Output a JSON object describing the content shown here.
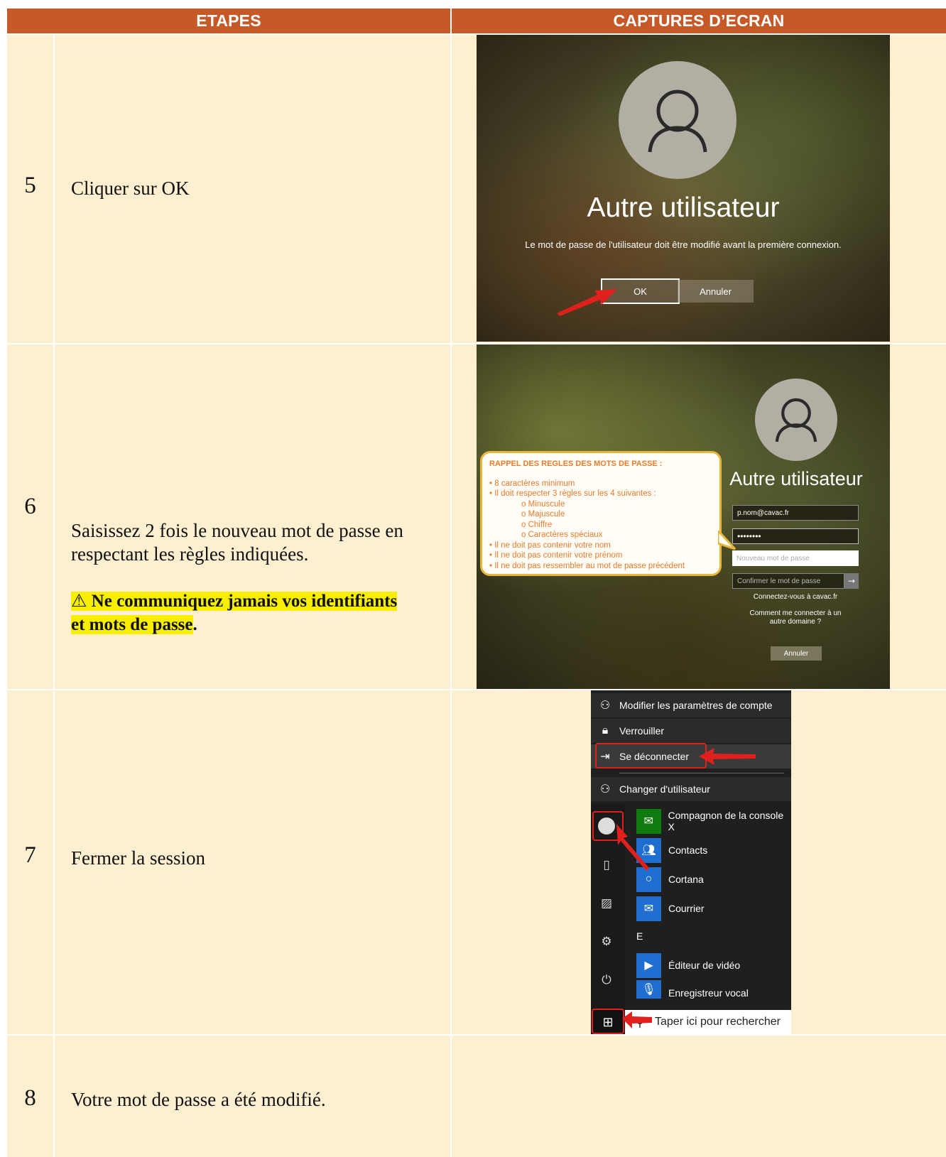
{
  "header": {
    "col1": "ETAPES",
    "col2": "CAPTURES D’ECRAN"
  },
  "rows": [
    {
      "num": "5",
      "text": "Cliquer sur OK"
    },
    {
      "num": "6",
      "text_line1": "Saisissez 2 fois le nouveau mot de passe en",
      "text_line2": "respectant les règles indiquées.",
      "warning_line1": "Ne communiquez jamais vos identifiants",
      "warning_line2": "et mots de passe",
      "warning_end": "."
    },
    {
      "num": "7",
      "text": "Fermer la session"
    },
    {
      "num": "8",
      "text": "Votre mot de passe a été modifié."
    }
  ],
  "shot5": {
    "title": "Autre utilisateur",
    "message": "Le mot de passe de l'utilisateur doit être modifié avant la première connexion.",
    "ok_label": "OK",
    "cancel_label": "Annuler"
  },
  "shot6": {
    "title": "Autre utilisateur",
    "username": "p.nom@cavac.fr",
    "password_mask": "••••••••",
    "new_password_placeholder": "Nouveau mot de passe",
    "confirm_placeholder": "Confirmer le mot de passe",
    "connect_link": "Connectez-vous à cavac.fr",
    "other_domain_link": "Comment me connecter à un autre domaine ?",
    "cancel_label": "Annuler",
    "callout_title": "RAPPEL DES REGLES DES MOTS DE PASSE :",
    "callout_lines": [
      "• 8 caractères minimum",
      "• Il doit respecter 3 règles sur les 4 suivantes :",
      "o Minuscule",
      "o Majuscule",
      "o Chiffre",
      "o Caractères spéciaux",
      "• Il ne doit pas contenir votre nom",
      "• Il ne doit pas contenir votre prénom",
      "• Il ne doit pas ressembler au mot de passe précédent"
    ]
  },
  "shot7": {
    "account_items": [
      "Modifier les paramètres de compte",
      "Verrouiller",
      "Se déconnecter",
      "Changer d'utilisateur"
    ],
    "apps": [
      "Compagnon de la console X",
      "Contacts",
      "Cortana",
      "Courrier"
    ],
    "section_letter": "E",
    "apps2": [
      "Éditeur de vidéo",
      "Enregistreur vocal"
    ],
    "search_placeholder": "Taper ici pour rechercher"
  },
  "colors": {
    "header_bg": "#c55a28",
    "cell_bg": "#fdefcf",
    "warning_highlight": "#f7ee00",
    "arrow_red": "#e0201c",
    "callout_text": "#e97b2d"
  }
}
